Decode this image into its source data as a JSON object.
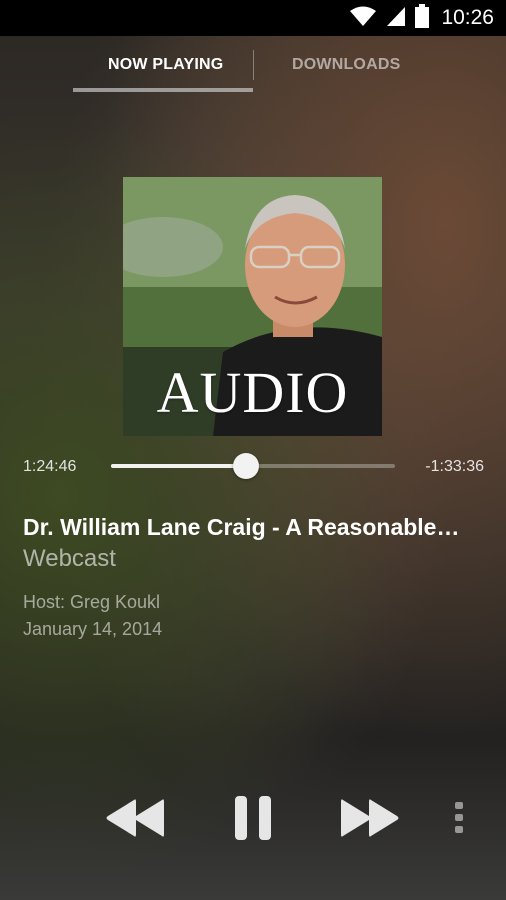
{
  "status_bar": {
    "time": "10:26",
    "icons": [
      "wifi-icon",
      "signal-icon",
      "battery-icon"
    ]
  },
  "tabs": [
    {
      "label": "NOW PLAYING",
      "active": true
    },
    {
      "label": "DOWNLOADS",
      "active": false
    }
  ],
  "album_art": {
    "label": "AUDIO"
  },
  "player": {
    "elapsed": "1:24:46",
    "remaining": "-1:33:36",
    "progress": 0.475
  },
  "track": {
    "title": "Dr. William Lane Craig - A Reasonable…",
    "subtitle": "Webcast",
    "host": "Host: Greg Koukl",
    "date": "January 14, 2014"
  },
  "controls": [
    "rewind-icon",
    "pause-icon",
    "fast-forward-icon",
    "more-vert-icon"
  ]
}
